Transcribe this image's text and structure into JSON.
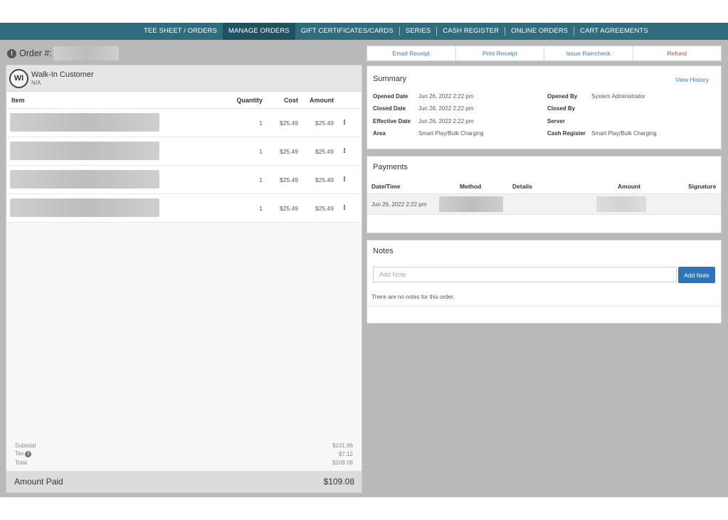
{
  "nav": {
    "items": [
      {
        "label": "TEE SHEET / ORDERS"
      },
      {
        "label": "MANAGE ORDERS"
      },
      {
        "label": "GIFT CERTIFICATES/CARDS"
      },
      {
        "label": "SERIES"
      },
      {
        "label": "CASH REGISTER"
      },
      {
        "label": "ONLINE ORDERS"
      },
      {
        "label": "CART AGREEMENTS"
      }
    ],
    "active_index": 1
  },
  "order": {
    "title": "Order #:"
  },
  "customer": {
    "initials": "WI",
    "name": "Walk-In Customer",
    "sub": "N/A"
  },
  "items_table": {
    "headers": {
      "item": "Item",
      "quantity": "Quantity",
      "cost": "Cost",
      "amount": "Amount"
    },
    "rows": [
      {
        "quantity": "1",
        "cost": "$25.49",
        "amount": "$25.49"
      },
      {
        "quantity": "1",
        "cost": "$25.49",
        "amount": "$25.49"
      },
      {
        "quantity": "1",
        "cost": "$25.49",
        "amount": "$25.49"
      },
      {
        "quantity": "1",
        "cost": "$25.49",
        "amount": "$25.49"
      }
    ],
    "menu_glyph": "⁝"
  },
  "totals": {
    "subtotal_label": "Subtotal",
    "subtotal": "$101.96",
    "tax_label": "Tax",
    "tax": "$7.12",
    "total_label": "Total",
    "total": "$109.08",
    "amount_paid_label": "Amount Paid",
    "amount_paid": "$109.08"
  },
  "actions": {
    "email_receipt": "Email Receipt",
    "print_receipt": "Print Receipt",
    "issue_raincheck": "Issue Raincheck",
    "refund": "Refund"
  },
  "summary": {
    "title": "Summary",
    "view_history": "View History",
    "opened_date_label": "Opened Date",
    "opened_date": "Jun 26, 2022 2:22 pm",
    "closed_date_label": "Closed Date",
    "closed_date": "Jun 26, 2022 2:22 pm",
    "effective_date_label": "Effective Date",
    "effective_date": "Jun 26, 2022 2:22 pm",
    "area_label": "Area",
    "area": "Smart Play/Bulk Charging",
    "opened_by_label": "Opened By",
    "opened_by": "System Administrator",
    "closed_by_label": "Closed By",
    "server_label": "Server",
    "cash_register_label": "Cash Register",
    "cash_register": "Smart Play/Bulk Charging"
  },
  "payments": {
    "title": "Payments",
    "headers": {
      "datetime": "Date/Time",
      "method": "Method",
      "details": "Details",
      "amount": "Amount",
      "signature": "Signature"
    },
    "rows": [
      {
        "datetime": "Jun 26, 2022 2:22 pm"
      }
    ]
  },
  "notes": {
    "title": "Notes",
    "placeholder": "Add Note",
    "add_button": "Add Note",
    "empty_text": "There are no notes for this order."
  }
}
